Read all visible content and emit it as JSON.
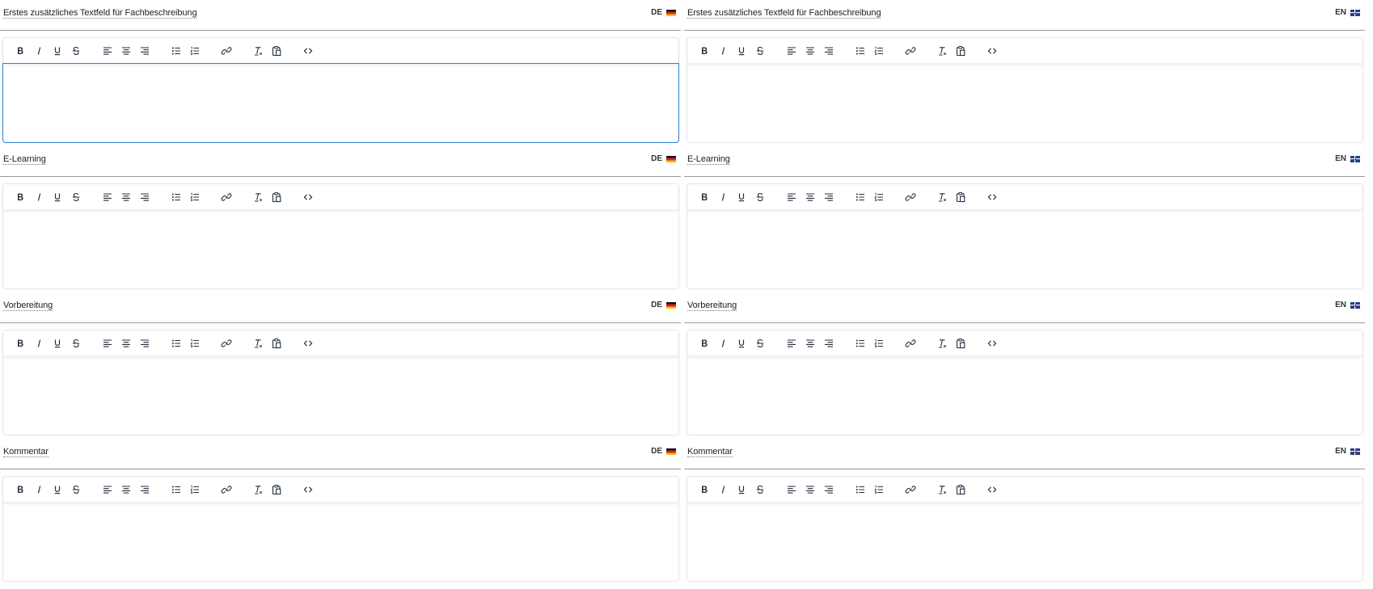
{
  "languages": {
    "de": {
      "code": "DE",
      "flag": "de-flag-icon"
    },
    "en": {
      "code": "EN",
      "flag": "gb-flag-icon"
    }
  },
  "fields": [
    {
      "label": "Erstes zusätzliches Textfeld für Fachbeschreibung"
    },
    {
      "label": "E-Learning"
    },
    {
      "label": "Vorbereitung"
    },
    {
      "label": "Kommentar"
    }
  ],
  "toolbar": {
    "bold": "B",
    "italic": "I",
    "underline": "U",
    "strike": "S",
    "code": "‹›"
  },
  "colors": {
    "focus_border": "#2a80d6",
    "flag_de": [
      "#111111",
      "#dd1f26",
      "#f2c400"
    ],
    "flag_en": "#1d3f8f"
  }
}
